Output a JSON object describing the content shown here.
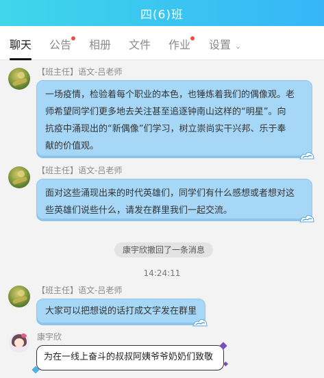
{
  "header": {
    "title": "四(6)班"
  },
  "tabs": [
    {
      "label": "聊天",
      "active": true,
      "dot": false
    },
    {
      "label": "公告",
      "active": false,
      "dot": true
    },
    {
      "label": "相册",
      "active": false,
      "dot": false
    },
    {
      "label": "文件",
      "active": false,
      "dot": false
    },
    {
      "label": "作业",
      "active": false,
      "dot": true
    },
    {
      "label": "设置",
      "active": false,
      "dot": false,
      "chevron": "chevron-down-icon"
    }
  ],
  "messages": [
    {
      "sender": "【班主任】语文-吕老师",
      "lines": [
        "一场疫情，检验着每个职业的本色，也锤炼着我们的偶像观。老",
        "师希望同学们更多地去关注甚至追逐钟南山这样的“明星”。向",
        "抗疫中涌现出的“新偶像”们学习，树立崇尚实干兴邦、乐于奉",
        "献的价值观。"
      ]
    },
    {
      "sender": "【班主任】语文-吕老师",
      "lines": [
        "面对这些涌现出来的时代英雄们，同学们有什么感想或者想对这",
        "些英雄们说些什么，请发在群里我们一起交流。"
      ]
    },
    {
      "system": "康宇欣撤回了一条消息"
    },
    {
      "time": "14:24:11"
    },
    {
      "sender": "【班主任】语文-吕老师",
      "lines": [
        "大家可以把想说的话打成文字发在群里"
      ]
    },
    {
      "sender": "康宇欣",
      "lines": [
        "为在一线上奋斗的叔叔阿姨爷爷奶奶们致敬"
      ]
    }
  ],
  "colors": {
    "header_start": "#3fd6ea",
    "header_end": "#36b6f7",
    "bubble": "#a7d7f7",
    "badge_dot": "#f04b4b"
  }
}
